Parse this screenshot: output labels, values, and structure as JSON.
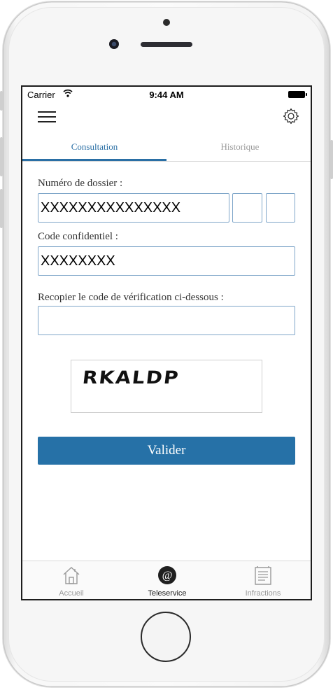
{
  "status_bar": {
    "carrier": "Carrier",
    "time": "9:44 AM"
  },
  "tabs": [
    {
      "label": "Consultation",
      "active": true
    },
    {
      "label": "Historique",
      "active": false
    }
  ],
  "form": {
    "dossier_label": "Numéro de dossier :",
    "dossier_value": "XXXXXXXXXXXXXXX",
    "dossier_value_2": "",
    "dossier_value_3": "",
    "code_label": "Code confidentiel :",
    "code_value": "XXXXXXXX",
    "verif_label": "Recopier le code de vérification ci-dessous :",
    "verif_value": "",
    "captcha_text": "RKALDP",
    "submit_label": "Valider"
  },
  "tab_bar": [
    {
      "label": "Accueil",
      "icon": "home-icon",
      "active": false
    },
    {
      "label": "Teleservice",
      "icon": "at-icon",
      "active": true
    },
    {
      "label": "Infractions",
      "icon": "document-icon",
      "active": false
    }
  ],
  "colors": {
    "accent": "#2671a7",
    "tab_active": "#2a6fa5",
    "field_border": "#7fa6c9"
  }
}
